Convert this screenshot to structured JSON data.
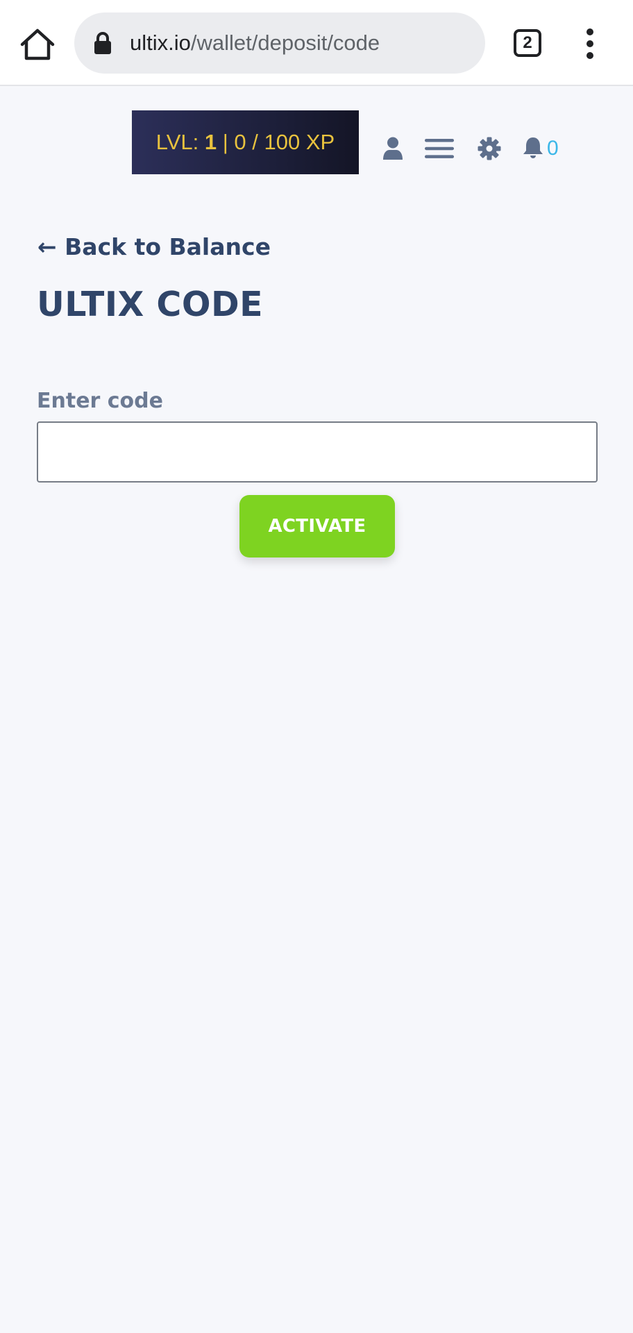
{
  "browser": {
    "url_host": "ultix.io",
    "url_path": "/wallet/deposit/code",
    "tab_count": "2",
    "icons": [
      "home-icon",
      "lock-icon",
      "tabs-icon",
      "more-vert-icon"
    ]
  },
  "header": {
    "level_label": "LVL: ",
    "level_value": "1",
    "separator": " | ",
    "xp_text": "0 / 100 XP",
    "notification_count": "0",
    "icons": [
      "user-icon",
      "hamburger-icon",
      "gear-icon",
      "bell-icon"
    ]
  },
  "main": {
    "back_arrow": "←",
    "back_label": "Back to Balance",
    "title": "ULTIX CODE",
    "field_label": "Enter code",
    "code_value": "",
    "activate_label": "ACTIVATE"
  },
  "colors": {
    "page_background": "#f6f7fb",
    "heading_text": "#304569",
    "label_text": "#6c7a93",
    "level_badge_text": "#e8c23e",
    "level_badge_bg": "#2c2f59",
    "notification_accent": "#3cb7e8",
    "activate_button": "#7ed321",
    "header_icons": "#5e6f8c"
  }
}
